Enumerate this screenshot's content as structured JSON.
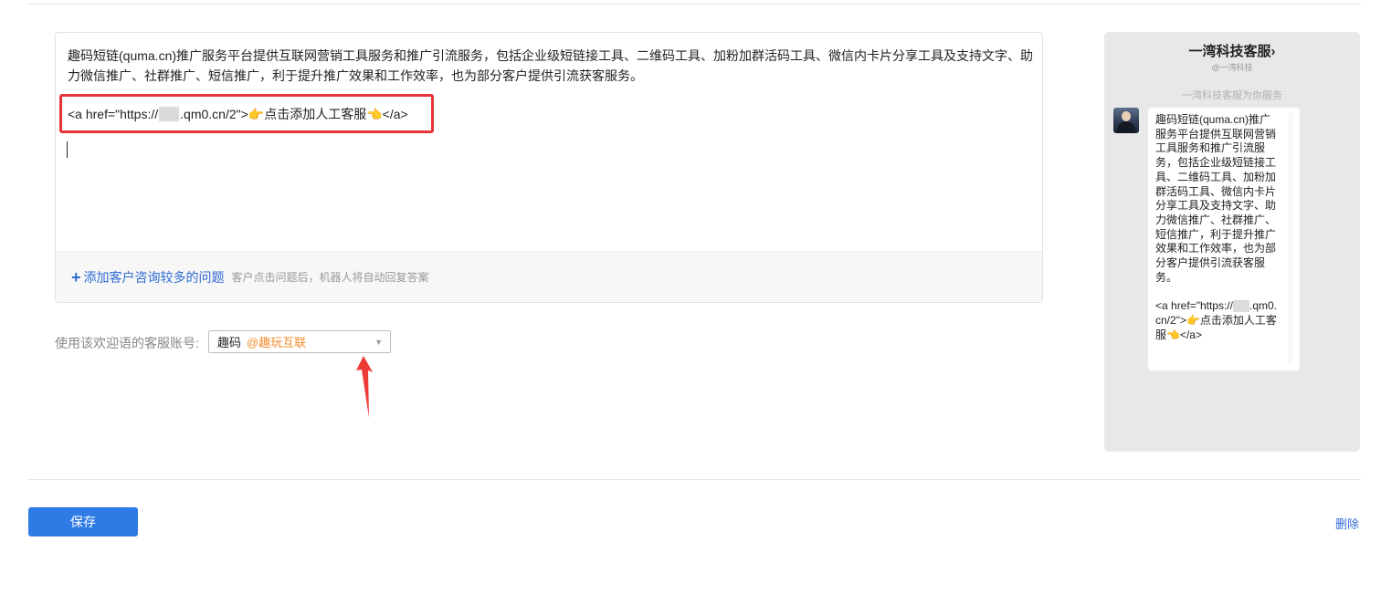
{
  "editor": {
    "welcome_text": "趣码短链(quma.cn)推广服务平台提供互联网营销工具服务和推广引流服务，包括企业级短链接工具、二维码工具、加粉加群活码工具、微信内卡片分享工具及支持文字、助力微信推广、社群推广、短信推广，利于提升推广效果和工作效率，也为部分客户提供引流获客服务。",
    "code_prefix": "<a href=\"https://",
    "code_suffix": ".qm0.cn/2\">👉点击添加人工客服👈</a>",
    "add_question_link": "添加客户咨询较多的问题",
    "add_question_hint": "客户点击问题后，机器人将自动回复答案"
  },
  "account": {
    "label": "使用该欢迎语的客服账号:",
    "selected_name": "趣码",
    "selected_org": "@趣玩互联"
  },
  "actions": {
    "save": "保存",
    "delete": "删除"
  },
  "preview": {
    "title": "一湾科技客服",
    "title_chevron": "›",
    "subtitle": "@一湾科技",
    "service_note": "一湾科技客服为你服务",
    "message": "趣码短链(quma.cn)推广服务平台提供互联网营销工具服务和推广引流服务，包括企业级短链接工具、二维码工具、加粉加群活码工具、微信内卡片分享工具及支持文字、助力微信推广、社群推广、短信推广，利于提升推广效果和工作效率，也为部分客户提供引流获客服务。",
    "code_prefix": "<a href=\"https://",
    "code_suffix": ".qm0.cn/2\">👉点击添加人工客服👈</a>"
  },
  "icons": {
    "add": "plus-icon",
    "dropdown": "caret-down-icon",
    "annotation": "red-arrow-icon"
  },
  "colors": {
    "accent": "#2f7be5",
    "link": "#2f6bd3",
    "highlight": "#e8333a",
    "org": "#f08a24"
  }
}
